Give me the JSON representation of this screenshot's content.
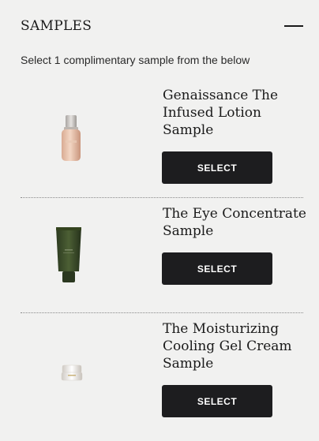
{
  "header": {
    "title": "SAMPLES",
    "collapse_icon": "minus-icon"
  },
  "subtitle": "Select 1 complimentary sample from the below",
  "samples": [
    {
      "name": "Genaissance The Infused Lotion Sample",
      "button_label": "SELECT",
      "image_icon": "lotion-bottle-icon"
    },
    {
      "name": "The Eye Concentrate Sample",
      "button_label": "SELECT",
      "image_icon": "eye-cream-tube-icon"
    },
    {
      "name": "The Moisturizing Cooling Gel Cream Sample",
      "button_label": "SELECT",
      "image_icon": "cream-jar-icon"
    }
  ],
  "colors": {
    "background": "#f1f1f0",
    "button": "#1d1d1f",
    "button_text": "#ffffff",
    "text": "#1a1a1a"
  }
}
